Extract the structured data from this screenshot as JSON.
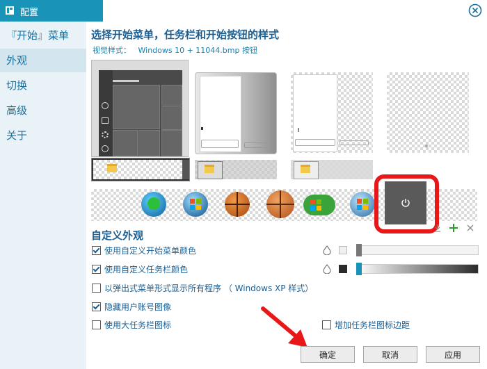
{
  "window": {
    "title": "配置"
  },
  "sidebar": {
    "items": [
      {
        "label": "『开始』菜单",
        "active": false
      },
      {
        "label": "外观",
        "active": true
      },
      {
        "label": "切换",
        "active": false
      },
      {
        "label": "高级",
        "active": false
      },
      {
        "label": "关于",
        "active": false
      }
    ]
  },
  "main": {
    "heading": "选择开始菜单，任务栏和开始按钮的样式",
    "visual_style_label": "视觉样式：",
    "visual_style_value": "Windows 10 + 11044.bmp 按钮",
    "custom_heading": "自定义外观",
    "options": [
      {
        "label": "使用自定义开始菜单颜色",
        "checked": true
      },
      {
        "label": "使用自定义任务栏颜色",
        "checked": true
      },
      {
        "label": "以弹出式菜单形式显示所有程序 （ Windows XP 样式）",
        "checked": false
      },
      {
        "label": "隐藏用户账号图像",
        "checked": true
      },
      {
        "label": "使用大任务栏图标",
        "checked": false
      }
    ],
    "extra_option": {
      "label": "增加任务栏图标边距",
      "checked": false
    },
    "start_menu_color": {
      "swatch": "#f0f0f0"
    },
    "taskbar_color": {
      "swatch": "#2b2b2b"
    }
  },
  "buttons": {
    "ok": "确定",
    "cancel": "取消",
    "apply": "应用"
  },
  "colors": {
    "accent": "#1a93b8",
    "highlight": "#e81818",
    "arrow": "#e81818"
  }
}
